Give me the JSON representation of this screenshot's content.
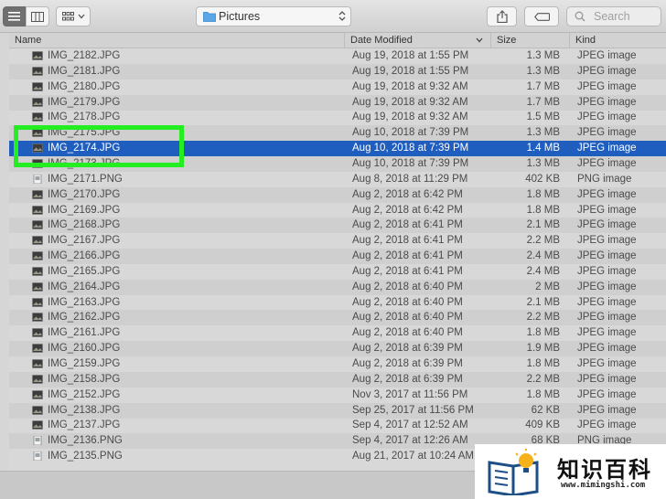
{
  "toolbar": {
    "path_label": "Pictures",
    "search_placeholder": "Search"
  },
  "columns": {
    "name": "Name",
    "date": "Date Modified",
    "size": "Size",
    "kind": "Kind"
  },
  "files": [
    {
      "name": "IMG_2182.JPG",
      "date": "Aug 19, 2018 at 1:55 PM",
      "size": "1.3 MB",
      "kind": "JPEG image"
    },
    {
      "name": "IMG_2181.JPG",
      "date": "Aug 19, 2018 at 1:55 PM",
      "size": "1.3 MB",
      "kind": "JPEG image"
    },
    {
      "name": "IMG_2180.JPG",
      "date": "Aug 19, 2018 at 9:32 AM",
      "size": "1.7 MB",
      "kind": "JPEG image"
    },
    {
      "name": "IMG_2179.JPG",
      "date": "Aug 19, 2018 at 9:32 AM",
      "size": "1.7 MB",
      "kind": "JPEG image"
    },
    {
      "name": "IMG_2178.JPG",
      "date": "Aug 19, 2018 at 9:32 AM",
      "size": "1.5 MB",
      "kind": "JPEG image"
    },
    {
      "name": "IMG_2175.JPG",
      "date": "Aug 10, 2018 at 7:39 PM",
      "size": "1.3 MB",
      "kind": "JPEG image"
    },
    {
      "name": "IMG_2174.JPG",
      "date": "Aug 10, 2018 at 7:39 PM",
      "size": "1.4 MB",
      "kind": "JPEG image",
      "selected": true
    },
    {
      "name": "IMG_2173.JPG",
      "date": "Aug 10, 2018 at 7:39 PM",
      "size": "1.3 MB",
      "kind": "JPEG image"
    },
    {
      "name": "IMG_2171.PNG",
      "date": "Aug 8, 2018 at 11:29 PM",
      "size": "402 KB",
      "kind": "PNG image"
    },
    {
      "name": "IMG_2170.JPG",
      "date": "Aug 2, 2018 at 6:42 PM",
      "size": "1.8 MB",
      "kind": "JPEG image"
    },
    {
      "name": "IMG_2169.JPG",
      "date": "Aug 2, 2018 at 6:42 PM",
      "size": "1.8 MB",
      "kind": "JPEG image"
    },
    {
      "name": "IMG_2168.JPG",
      "date": "Aug 2, 2018 at 6:41 PM",
      "size": "2.1 MB",
      "kind": "JPEG image"
    },
    {
      "name": "IMG_2167.JPG",
      "date": "Aug 2, 2018 at 6:41 PM",
      "size": "2.2 MB",
      "kind": "JPEG image"
    },
    {
      "name": "IMG_2166.JPG",
      "date": "Aug 2, 2018 at 6:41 PM",
      "size": "2.4 MB",
      "kind": "JPEG image"
    },
    {
      "name": "IMG_2165.JPG",
      "date": "Aug 2, 2018 at 6:41 PM",
      "size": "2.4 MB",
      "kind": "JPEG image"
    },
    {
      "name": "IMG_2164.JPG",
      "date": "Aug 2, 2018 at 6:40 PM",
      "size": "2 MB",
      "kind": "JPEG image"
    },
    {
      "name": "IMG_2163.JPG",
      "date": "Aug 2, 2018 at 6:40 PM",
      "size": "2.1 MB",
      "kind": "JPEG image"
    },
    {
      "name": "IMG_2162.JPG",
      "date": "Aug 2, 2018 at 6:40 PM",
      "size": "2.2 MB",
      "kind": "JPEG image"
    },
    {
      "name": "IMG_2161.JPG",
      "date": "Aug 2, 2018 at 6:40 PM",
      "size": "1.8 MB",
      "kind": "JPEG image"
    },
    {
      "name": "IMG_2160.JPG",
      "date": "Aug 2, 2018 at 6:39 PM",
      "size": "1.9 MB",
      "kind": "JPEG image"
    },
    {
      "name": "IMG_2159.JPG",
      "date": "Aug 2, 2018 at 6:39 PM",
      "size": "1.8 MB",
      "kind": "JPEG image"
    },
    {
      "name": "IMG_2158.JPG",
      "date": "Aug 2, 2018 at 6:39 PM",
      "size": "2.2 MB",
      "kind": "JPEG image"
    },
    {
      "name": "IMG_2152.JPG",
      "date": "Nov 3, 2017 at 11:56 PM",
      "size": "1.8 MB",
      "kind": "JPEG image"
    },
    {
      "name": "IMG_2138.JPG",
      "date": "Sep 25, 2017 at 11:56 PM",
      "size": "62 KB",
      "kind": "JPEG image"
    },
    {
      "name": "IMG_2137.JPG",
      "date": "Sep 4, 2017 at 12:52 AM",
      "size": "409 KB",
      "kind": "JPEG image"
    },
    {
      "name": "IMG_2136.PNG",
      "date": "Sep 4, 2017 at 12:26 AM",
      "size": "68 KB",
      "kind": "PNG image"
    },
    {
      "name": "IMG_2135.PNG",
      "date": "Aug 21, 2017 at 10:24 AM",
      "size": "",
      "kind": ""
    }
  ],
  "watermark": {
    "cn": "知识百科",
    "url": "www.mimingshi.com"
  },
  "colors": {
    "selection": "#1f5dbf",
    "highlight": "#22ee22"
  }
}
